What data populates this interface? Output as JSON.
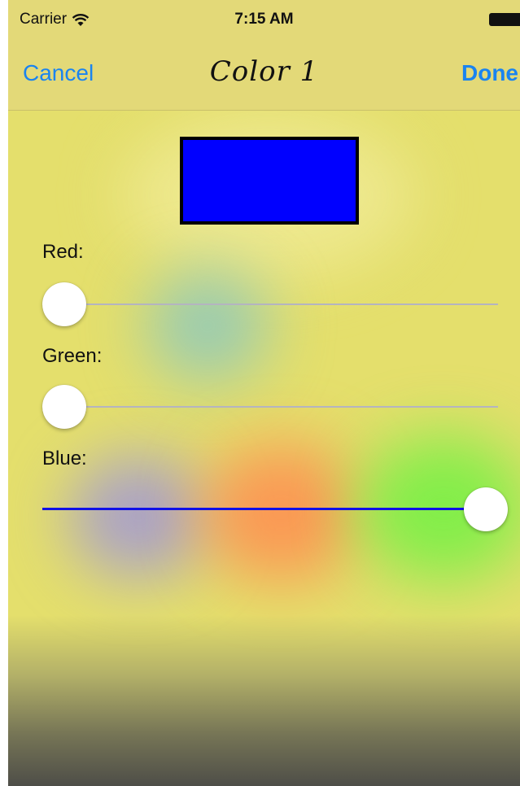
{
  "status_bar": {
    "carrier": "Carrier",
    "time": "7:15 AM",
    "icons": [
      "wifi-icon",
      "battery-icon"
    ]
  },
  "nav": {
    "cancel_label": "Cancel",
    "title": "Color 1",
    "done_label": "Done"
  },
  "swatch": {
    "color": "#0000ff"
  },
  "sliders": [
    {
      "label": "Red:",
      "value": 0.0,
      "fill_color": "#1010e6"
    },
    {
      "label": "Green:",
      "value": 0.0,
      "fill_color": "#1010e6"
    },
    {
      "label": "Blue:",
      "value": 1.0,
      "fill_color": "#1010e6"
    }
  ],
  "colors": {
    "accent": "#1a84f0",
    "bar_background": "#e3d978",
    "screen_background": "#e4df6c"
  }
}
